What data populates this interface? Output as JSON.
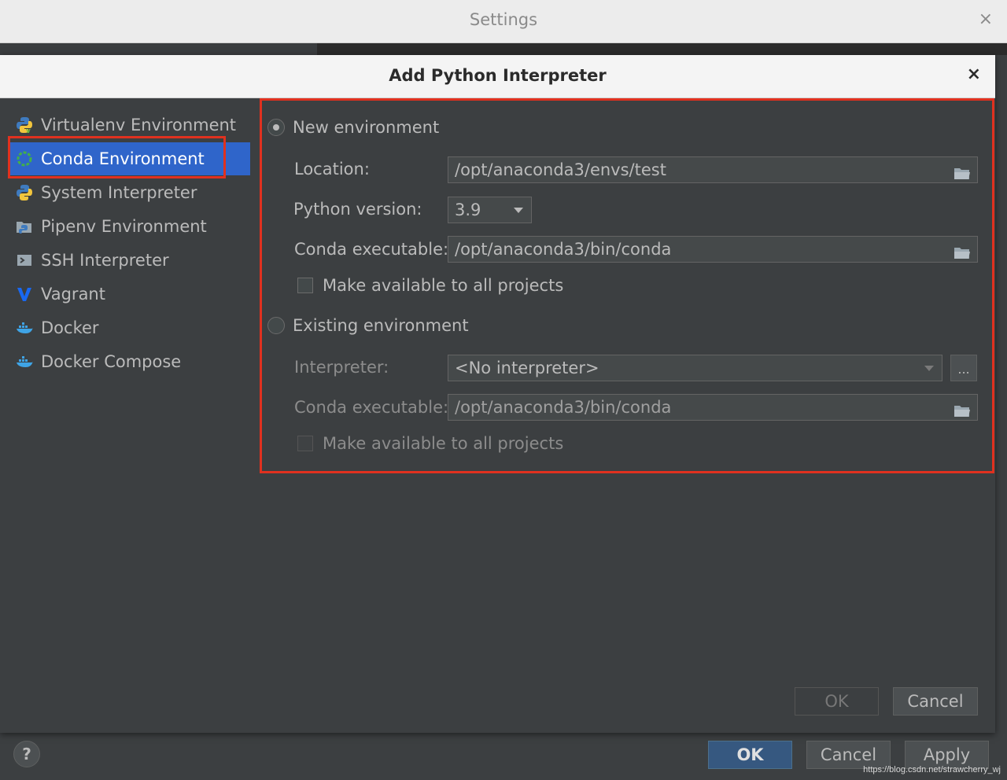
{
  "settings": {
    "title": "Settings",
    "close_glyph": "×",
    "help_glyph": "?",
    "buttons": {
      "ok": "OK",
      "cancel": "Cancel",
      "apply": "Apply"
    },
    "watermark": "https://blog.csdn.net/strawcherry_wj"
  },
  "dialog": {
    "title": "Add Python Interpreter",
    "close_glyph": "×",
    "sidebar": {
      "items": [
        {
          "label": "Virtualenv Environment",
          "icon": "python-virtualenv-icon",
          "selected": false
        },
        {
          "label": "Conda Environment",
          "icon": "conda-icon",
          "selected": true
        },
        {
          "label": "System Interpreter",
          "icon": "python-icon",
          "selected": false
        },
        {
          "label": "Pipenv Environment",
          "icon": "pipenv-icon",
          "selected": false
        },
        {
          "label": "SSH Interpreter",
          "icon": "ssh-icon",
          "selected": false
        },
        {
          "label": "Vagrant",
          "icon": "vagrant-icon",
          "selected": false
        },
        {
          "label": "Docker",
          "icon": "docker-icon",
          "selected": false
        },
        {
          "label": "Docker Compose",
          "icon": "docker-compose-icon",
          "selected": false
        }
      ]
    },
    "new_env": {
      "radio_label": "New environment",
      "selected": true,
      "location_label": "Location:",
      "location_value": "/opt/anaconda3/envs/test",
      "python_version_label": "Python version:",
      "python_version_value": "3.9",
      "conda_exec_label": "Conda executable:",
      "conda_exec_value": "/opt/anaconda3/bin/conda",
      "make_available_label": "Make available to all projects",
      "make_available_checked": false
    },
    "existing_env": {
      "radio_label": "Existing environment",
      "selected": false,
      "interpreter_label": "Interpreter:",
      "interpreter_value": "<No interpreter>",
      "browse_label": "...",
      "conda_exec_label": "Conda executable:",
      "conda_exec_value": "/opt/anaconda3/bin/conda",
      "make_available_label": "Make available to all projects",
      "make_available_checked": false
    },
    "buttons": {
      "ok": "OK",
      "cancel": "Cancel"
    },
    "highlight_color": "#e0311f",
    "selection_color": "#2f65ca"
  }
}
